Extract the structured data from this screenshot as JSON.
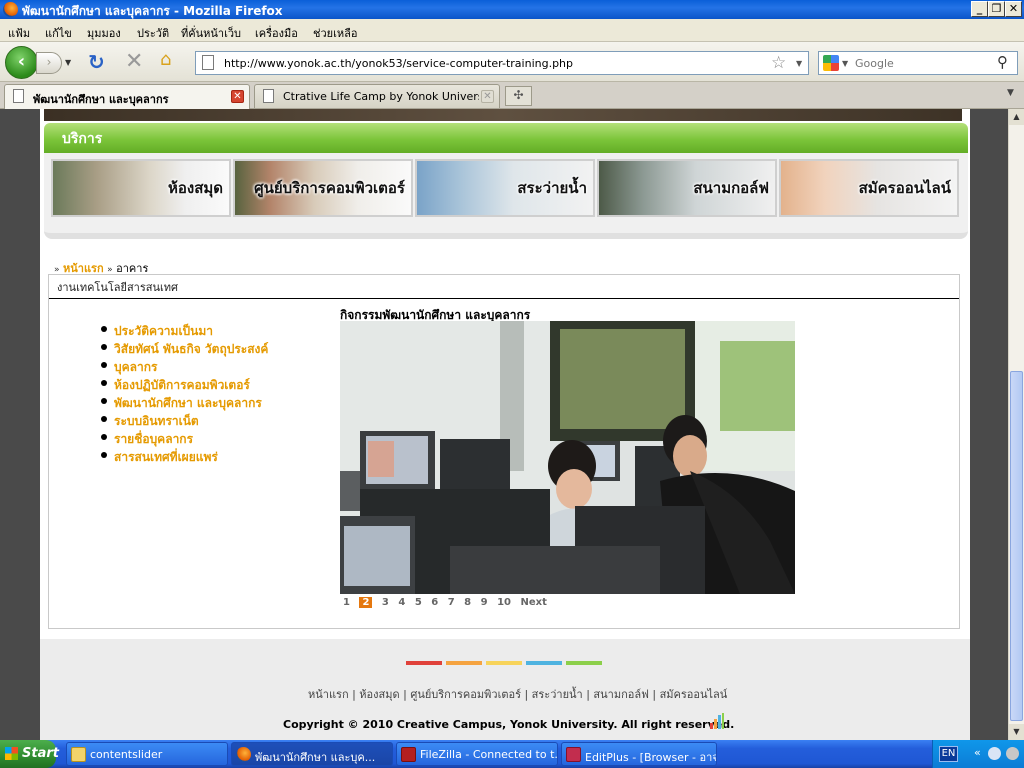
{
  "window": {
    "title": "พัฒนานักศึกษา และบุคลากร - Mozilla Firefox",
    "btn_min": "_",
    "btn_max": "❐",
    "btn_close": "✕"
  },
  "menu": [
    "แฟ้ม",
    "แก้ไข",
    "มุมมอง",
    "ประวัติ",
    "ที่คั่นหน้าเว็บ",
    "เครื่องมือ",
    "ช่วยเหลือ"
  ],
  "nav": {
    "url": "http://www.yonok.ac.th/yonok53/service-computer-training.php",
    "search_placeholder": "Google"
  },
  "tabs": [
    {
      "label": "พัฒนานักศึกษา และบุคลากร",
      "active": true
    },
    {
      "label": "Ctrative Life Camp by Yonok University...",
      "active": false
    }
  ],
  "page": {
    "section_header": "บริการ",
    "banners": [
      "ห้องสมุด",
      "ศูนย์บริการคอมพิวเตอร์",
      "สระว่ายน้ำ",
      "สนามกอล์ฟ",
      "สมัครออนไลน์"
    ],
    "breadcrumb": {
      "home": "หน้าแรก",
      "current": "อาคาร"
    },
    "section_title": "งานเทคโนโลยีสารสนเทศ",
    "side_menu": [
      "ประวัติความเป็นมา",
      "วิสัยทัศน์ พันธกิจ วัตถุประสงค์",
      "บุคลากร",
      "ห้องปฏิบัติการคอมพิวเตอร์",
      "พัฒนานักศึกษา และบุคลากร",
      "ระบบอินทราเน็ต",
      "รายชื่อบุคลากร",
      "สารสนเทศที่เผยแพร่"
    ],
    "activity_title": "กิจกรรมพัฒนานักศึกษา และบุคลากร",
    "pager": {
      "pages": [
        "1",
        "2",
        "3",
        "4",
        "5",
        "6",
        "7",
        "8",
        "9",
        "10"
      ],
      "current": "2",
      "next": "Next"
    },
    "footer_links": "หน้าแรก | ห้องสมุด | ศูนย์บริการคอมพิวเตอร์ | สระว่ายน้ำ | สนามกอล์ฟ | สมัครออนไลน์",
    "copyright": "Copyright © 2010 Creative Campus, Yonok University. All right reserved.",
    "footer_colors": [
      "#e0413a",
      "#f5a340",
      "#f7d35a",
      "#4fb3e0",
      "#8ccf4a"
    ]
  },
  "taskbar": {
    "start": "Start",
    "tasks": [
      "contentslider",
      "พัฒนานักศึกษา และบุค...",
      "FileZilla - Connected to t...",
      "EditPlus - [Browser - อาจ..."
    ],
    "lang": "EN",
    "tray_expand": "«"
  }
}
